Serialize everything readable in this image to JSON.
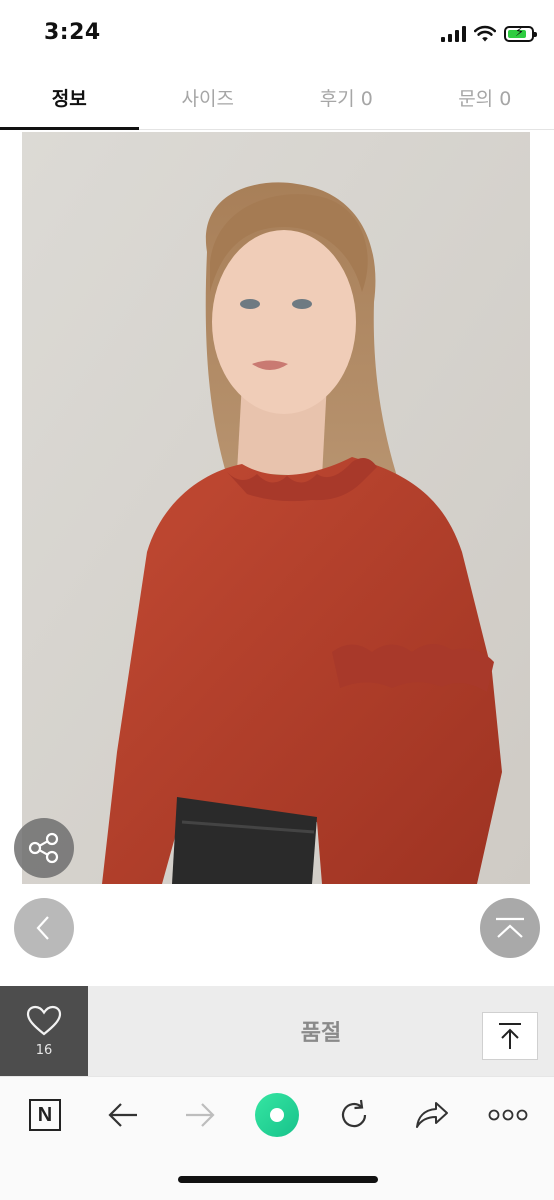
{
  "status_bar": {
    "time": "3:24",
    "battery_color": "#2ecc40"
  },
  "tabs": [
    {
      "label": "정보",
      "active": true
    },
    {
      "label": "사이즈",
      "active": false
    },
    {
      "label": "후기 0",
      "active": false
    },
    {
      "label": "문의 0",
      "active": false
    }
  ],
  "product": {
    "image_icon": "product-photo",
    "blouse_color": "#b3402a"
  },
  "controls": {
    "share_icon": "share-icon",
    "prev_icon": "chevron-left-icon",
    "top_icon": "chevron-up-icon"
  },
  "action_bar": {
    "like_count": "16",
    "soldout_label": "품절",
    "scroll_top_icon": "arrow-up-to-top-icon"
  },
  "browser": {
    "n_label": "N",
    "icons": [
      "naver-n-icon",
      "back-arrow-icon",
      "forward-arrow-icon",
      "green-dot-icon",
      "reload-icon",
      "share-arrow-icon",
      "more-icon"
    ]
  }
}
